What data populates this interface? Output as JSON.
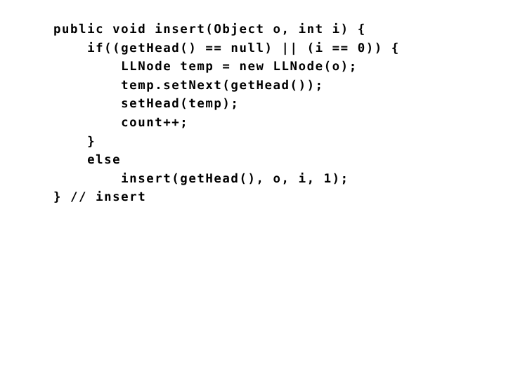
{
  "slide": {
    "background_color": "#ffffff",
    "text_color": "#000000",
    "language": "java",
    "method_name": "insert"
  },
  "code": {
    "lines": [
      "public void insert(Object o, int i) {",
      "    if((getHead() == null) || (i == 0)) {",
      "        LLNode temp = new LLNode(o);",
      "        temp.setNext(getHead());",
      "        setHead(temp);",
      "        count++;",
      "    }",
      "    else",
      "        insert(getHead(), o, i, 1);",
      "} // insert"
    ]
  }
}
